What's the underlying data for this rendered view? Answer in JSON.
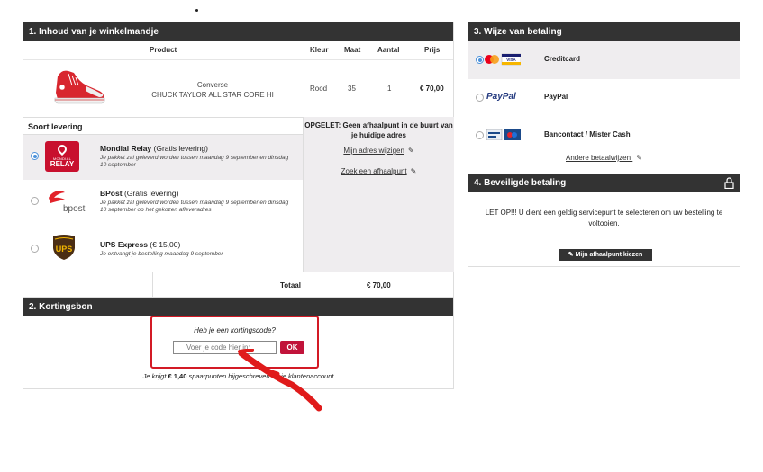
{
  "cart": {
    "title": "1. Inhoud van je winkelmandje",
    "columns": [
      "Product",
      "Kleur",
      "Maat",
      "Aantal",
      "Prijs"
    ],
    "item": {
      "brand": "Converse",
      "name": "CHUCK TAYLOR ALL STAR CORE HI",
      "color": "Rood",
      "size": "35",
      "qty": "1",
      "price": "€ 70,00"
    },
    "shipping": {
      "title": "Soort levering",
      "options": [
        {
          "name": "Mondial Relay",
          "note": "(Gratis levering)",
          "desc": "Je pakket zal geleverd worden tussen maandag 9 september en dinsdag 10 september",
          "logo_text_1": "MONDIAL",
          "logo_text_2": "RELAY"
        },
        {
          "name": "BPost",
          "note": "(Gratis levering)",
          "desc": "Je pakket zal geleverd worden tussen maandag 9 september en dinsdag 10 september op het gekozen afleveradres",
          "logo_text": "bpost"
        },
        {
          "name": "UPS Express",
          "note": "(€ 15,00)",
          "desc": "Je ontvangt je bestelling maandag 9 september",
          "logo_text": "UPS"
        }
      ],
      "selected_index": 0
    },
    "notice": "OPGELET: Geen afhaalpunt in de buurt van je huidige adres",
    "change_address": "Mijn adres wijzigen",
    "find_pickup": "Zoek een afhaalpunt",
    "total_label": "Totaal",
    "total_value": "€ 70,00"
  },
  "coupon": {
    "title": "2. Kortingsbon",
    "question": "Heb je een kortingscode?",
    "placeholder": "Voer je code hier in:",
    "ok_label": "OK",
    "points_prefix": "Je krijgt",
    "points_amount": "€ 1,40",
    "points_suffix": "spaarpunten bijgeschreven op je klantenaccount"
  },
  "payment": {
    "title": "3. Wijze van betaling",
    "options": [
      {
        "name": "Creditcard"
      },
      {
        "name": "PayPal",
        "logo_text": "PayPal"
      },
      {
        "name": "Bancontact / Mister Cash"
      }
    ],
    "selected_index": 0,
    "more_methods": "Andere betaalwijzen"
  },
  "security": {
    "title": "4. Beveiligde betaling",
    "message": "LET OP!!! U dient een geldig servicepunt te selecteren om uw bestelling te voltooien.",
    "button_label": "Mijn afhaalpunt kiezen"
  },
  "colors": {
    "header_bg": "#333333",
    "accent_red": "#c1133a",
    "highlight_box": "#d31a25",
    "selected_bg": "#efedef"
  }
}
